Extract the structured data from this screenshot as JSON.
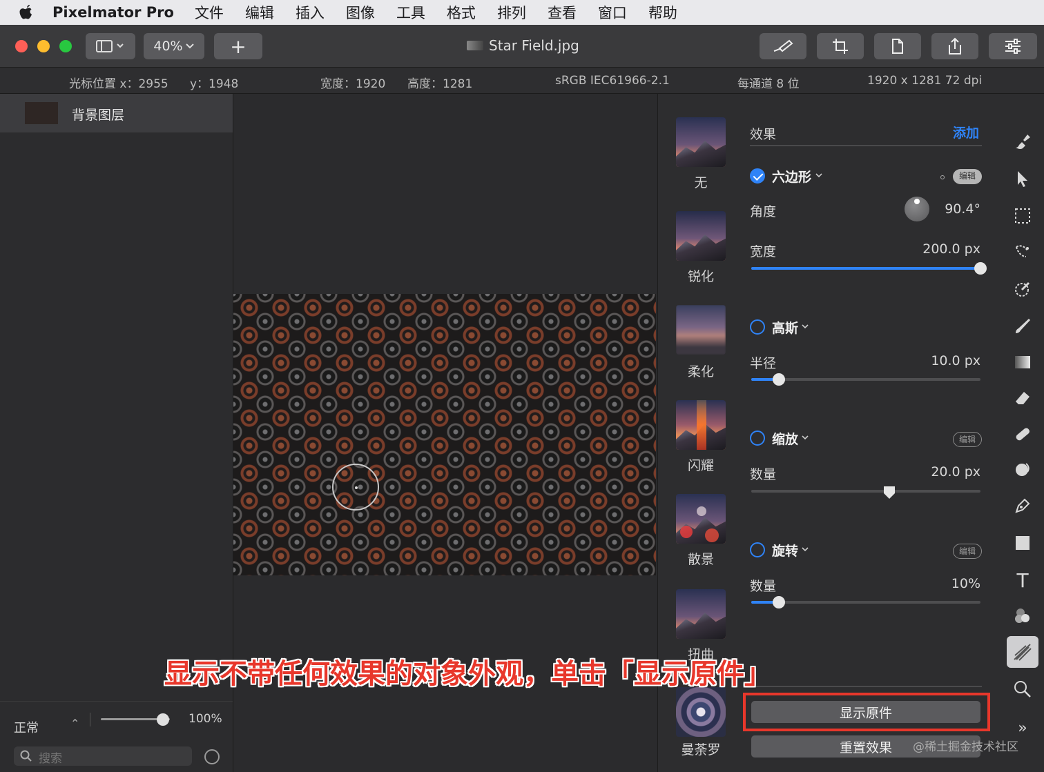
{
  "menubar": {
    "app_name": "Pixelmator Pro",
    "items": [
      "文件",
      "编辑",
      "插入",
      "图像",
      "工具",
      "格式",
      "排列",
      "查看",
      "窗口",
      "帮助"
    ]
  },
  "toolbar": {
    "zoom": "40%",
    "add_label": "+",
    "doc_title": "Star Field.jpg"
  },
  "info": {
    "cursor_x": "光标位置 x：2955",
    "cursor_y": "y：1948",
    "width": "宽度：1920",
    "height": "高度：1281",
    "profile": "sRGB IEC61966-2.1",
    "depth": "每通道 8 位",
    "size": "1920 x 1281 72 dpi"
  },
  "layers": {
    "layer_name": "背景图层",
    "blend_mode": "正常",
    "opacity": "100%",
    "opacity_fraction": 0.9,
    "search_placeholder": "搜索"
  },
  "presets": [
    "无",
    "锐化",
    "柔化",
    "闪耀",
    "散景",
    "扭曲",
    "曼荼罗"
  ],
  "effects": {
    "header": "效果",
    "add": "添加",
    "edit": "编辑",
    "hexagon": {
      "name": "六边形",
      "angle_label": "角度",
      "angle_value": "90.4°",
      "width_label": "宽度",
      "width_value": "200.0 px",
      "width_fraction": 1.0
    },
    "gaussian": {
      "name": "高斯",
      "radius_label": "半径",
      "radius_value": "10.0 px",
      "radius_fraction": 0.12
    },
    "zoom": {
      "name": "缩放",
      "amount_label": "数量",
      "amount_value": "20.0 px",
      "amount_fraction": 0.6
    },
    "rotate": {
      "name": "旋转",
      "amount_label": "数量",
      "amount_value": "10%",
      "amount_fraction": 0.12
    },
    "show_original": "显示原件",
    "reset": "重置效果"
  },
  "annotation": "显示不带任何效果的对象外观，单击「显示原件」",
  "watermark": "@稀土掘金技术社区",
  "colors": {
    "accent": "#2f83f7",
    "annotation": "#e8372b"
  }
}
